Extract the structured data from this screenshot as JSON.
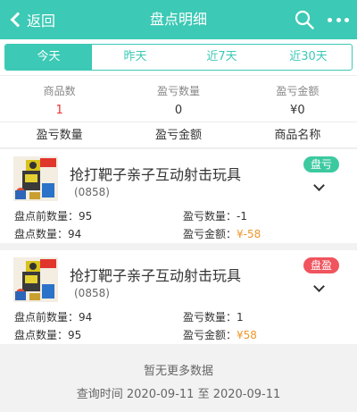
{
  "header": {
    "back_label": "返回",
    "title": "盘点明细"
  },
  "tabs": [
    {
      "label": "今天",
      "active": true
    },
    {
      "label": "昨天",
      "active": false
    },
    {
      "label": "近7天",
      "active": false
    },
    {
      "label": "近30天",
      "active": false
    }
  ],
  "summary": {
    "product_count_label": "商品数",
    "product_count_value": "1",
    "diff_qty_label": "盈亏数量",
    "diff_qty_value": "0",
    "diff_amount_label": "盈亏金额",
    "diff_amount_value": "¥0"
  },
  "sort": {
    "qty": "盈亏数量",
    "amount": "盈亏金额",
    "name": "商品名称"
  },
  "items": [
    {
      "name": "抢打靶子亲子互动射击玩具",
      "code": "(0858)",
      "badge": "盘亏",
      "before_label": "盘点前数量：",
      "before_value": "95",
      "after_label": "盘点数量：",
      "after_value": "94",
      "diff_qty_label": "盈亏数量：",
      "diff_qty_value": "-1",
      "diff_amount_label": "盈亏金额：",
      "diff_amount_value": "¥-58"
    },
    {
      "name": "抢打靶子亲子互动射击玩具",
      "code": "(0858)",
      "badge": "盘盈",
      "before_label": "盘点前数量：",
      "before_value": "94",
      "after_label": "盘点数量：",
      "after_value": "95",
      "diff_qty_label": "盈亏数量：",
      "diff_qty_value": "1",
      "diff_amount_label": "盈亏金额：",
      "diff_amount_value": "¥58"
    }
  ],
  "footer": {
    "no_more": "暂无更多数据",
    "query_time": "查询时间 2020-09-11 至 2020-09-11"
  },
  "colors": {
    "accent": "#3cc9b5",
    "loss_badge": "#3cc9a0",
    "gain_badge": "#f0545e",
    "amount": "#f0962a"
  }
}
